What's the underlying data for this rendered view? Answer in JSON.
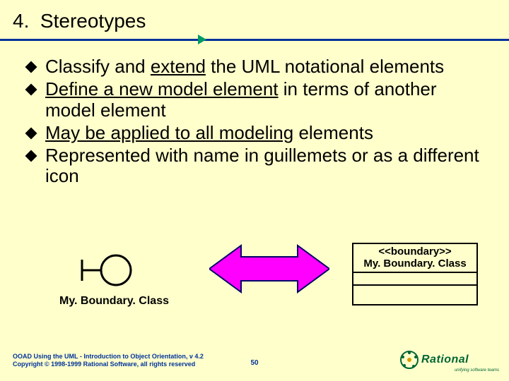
{
  "slide": {
    "number": "4.",
    "title": "Stereotypes",
    "bullets": [
      {
        "pre": "Classify and ",
        "u": "extend",
        "post": " the UML notational elements"
      },
      {
        "pre": "",
        "u": "Define a new model element",
        "post": " in terms of another model element"
      },
      {
        "pre": "",
        "u": "May be applied to all modeling",
        "post": " elements"
      },
      {
        "pre": "Represented with name in guillemets or as a different icon",
        "u": "",
        "post": ""
      }
    ],
    "boundary_label": "My. Boundary. Class",
    "classbox": {
      "stereo": "<<boundary>>",
      "name": "My. Boundary. Class"
    },
    "footer": {
      "line1": "OOAD Using the UML - Introduction to Object Orientation, v 4.2",
      "line2": "Copyright © 1998-1999 Rational Software, all rights reserved",
      "page": "50",
      "brand": "Rational",
      "tag": "unifying software teams"
    }
  }
}
